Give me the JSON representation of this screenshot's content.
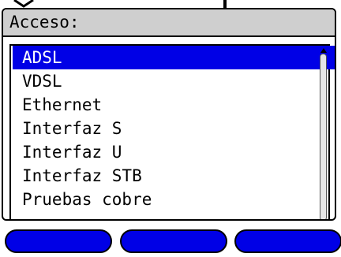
{
  "header": {
    "title": "Acceso:"
  },
  "menu": {
    "items": [
      {
        "label": "ADSL",
        "selected": true
      },
      {
        "label": "VDSL",
        "selected": false
      },
      {
        "label": "Ethernet",
        "selected": false
      },
      {
        "label": "Interfaz S",
        "selected": false
      },
      {
        "label": "Interfaz U",
        "selected": false
      },
      {
        "label": "Interfaz STB",
        "selected": false
      },
      {
        "label": "Pruebas cobre",
        "selected": false
      }
    ]
  },
  "softkeys": [
    {
      "label": ""
    },
    {
      "label": ""
    },
    {
      "label": ""
    }
  ],
  "colors": {
    "selection": "#0000e6",
    "title_bar": "#cfcfcf",
    "softkey": "#0000e6"
  }
}
